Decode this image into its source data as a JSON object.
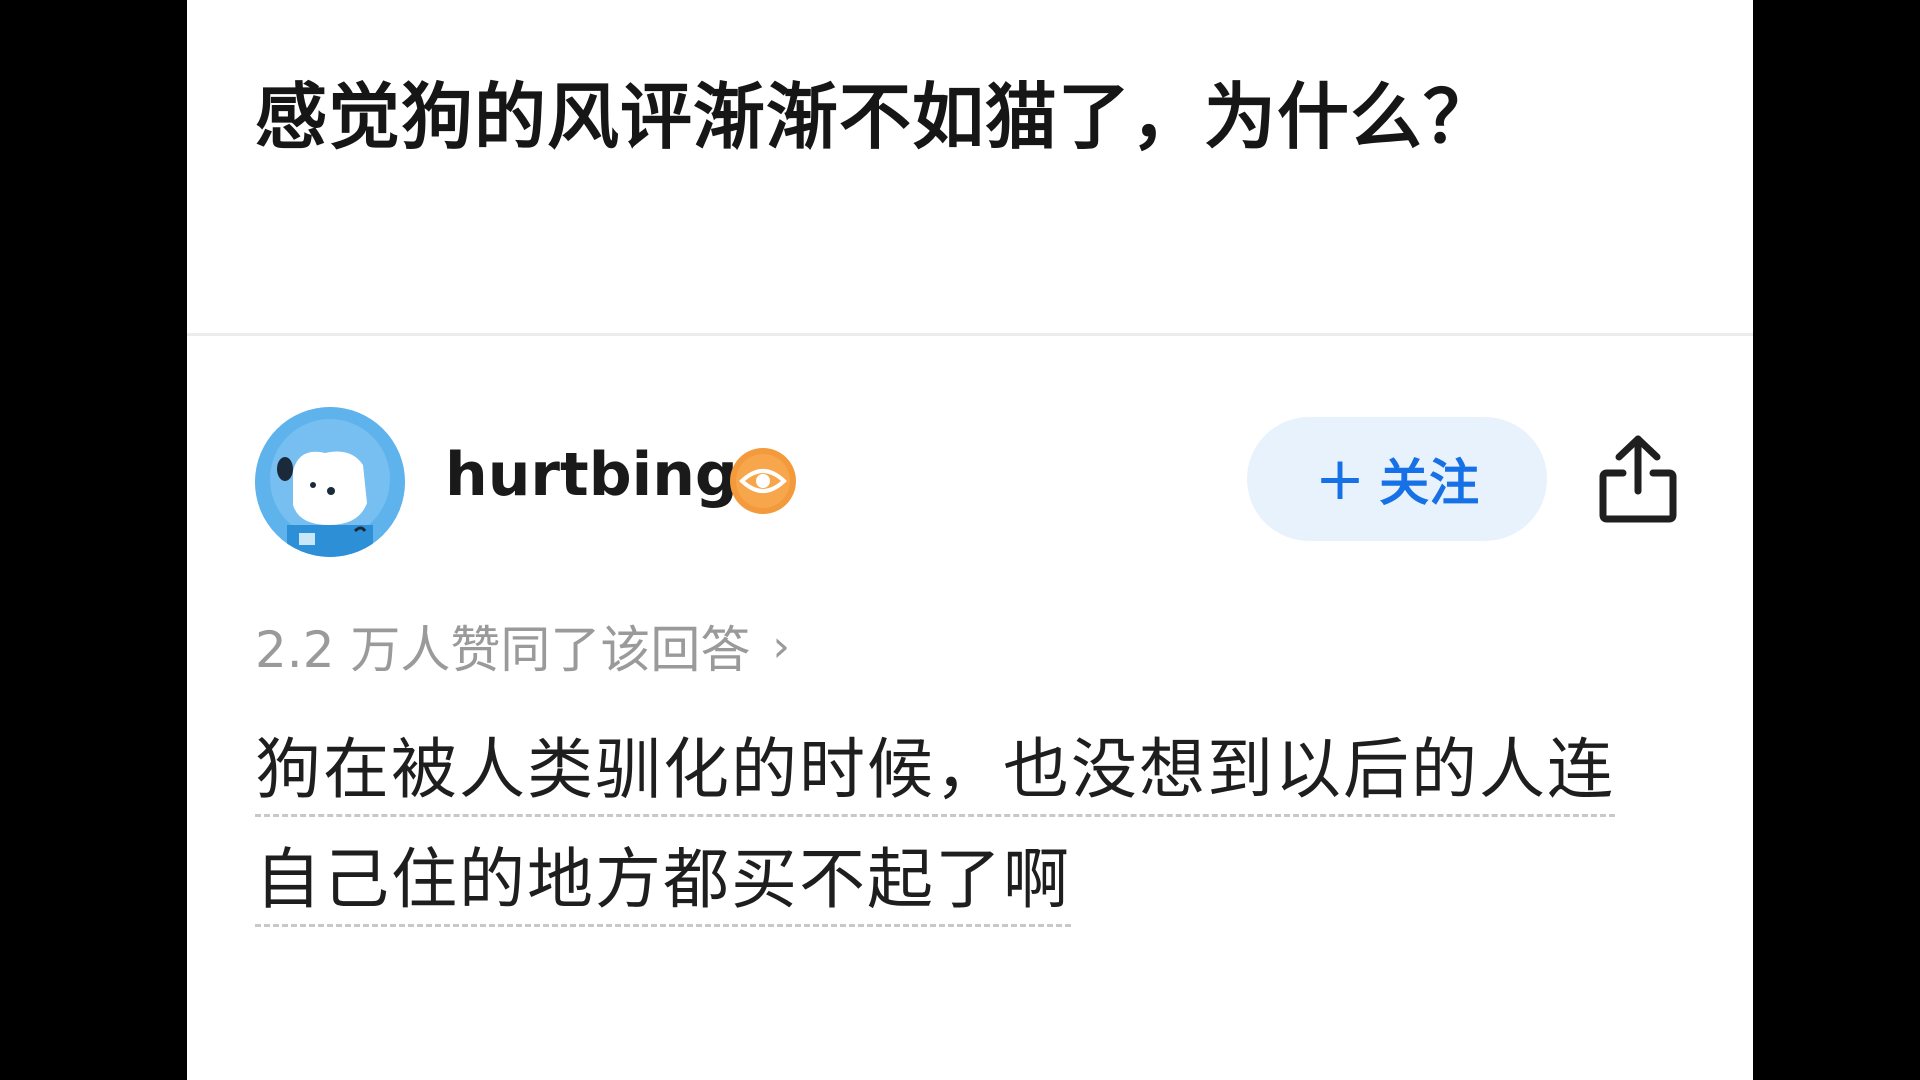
{
  "question": {
    "title": "感觉狗的风评渐渐不如猫了，为什么？"
  },
  "author": {
    "name": "hurtbing",
    "avatar": "dog-avatar",
    "badge_icon": "eye-badge-icon"
  },
  "actions": {
    "follow_plus": "+",
    "follow_label": "关注",
    "share_icon": "share-icon"
  },
  "answer": {
    "agree_text": "2.2 万人赞同了该回答",
    "agree_chevron": "›",
    "line1": "狗在被人类驯化的时候，也没想到以后的人连",
    "line2": "自己住的地方都买不起了啊"
  },
  "colors": {
    "follow_bg": "#e8f2fc",
    "follow_text": "#1771e6",
    "badge": "#f39a3c",
    "avatar_bg": "#5fb3ec"
  }
}
